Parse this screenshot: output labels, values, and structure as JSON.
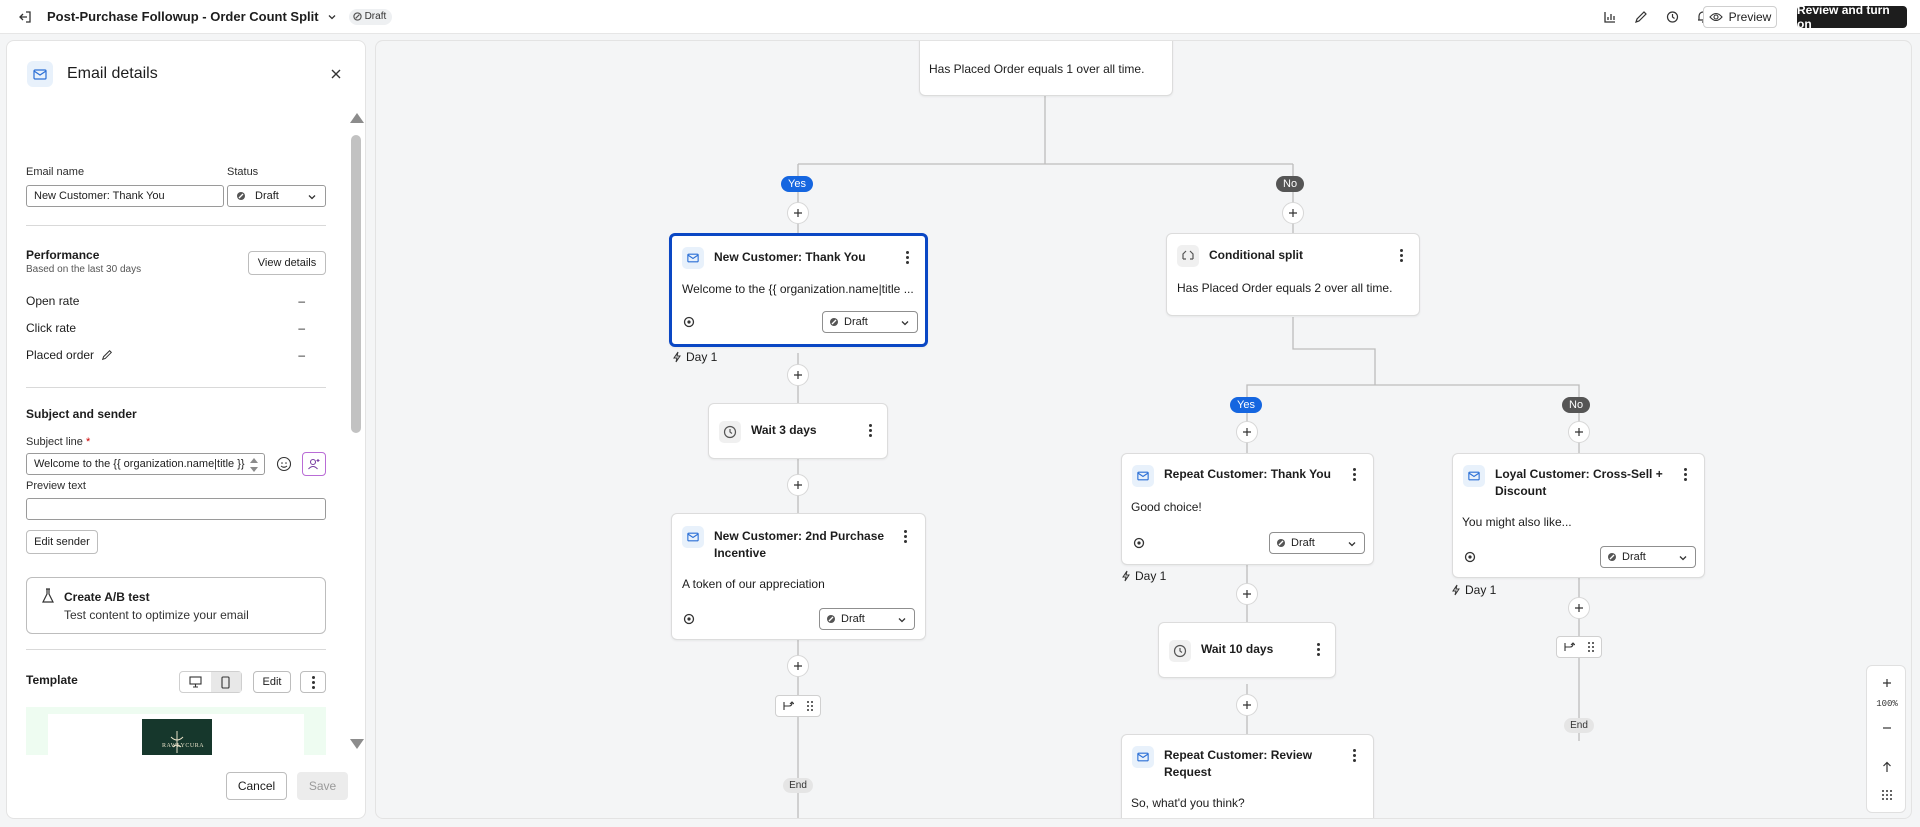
{
  "topbar": {
    "title": "Post-Purchase Followup - Order Count Split",
    "status": "Draft",
    "preview_label": "Preview",
    "review_label": "Review and turn on"
  },
  "panel": {
    "title": "Email details",
    "email_name_label": "Email name",
    "email_name_value": "New Customer: Thank You",
    "status_label": "Status",
    "status_value": "Draft",
    "performance_title": "Performance",
    "performance_sub": "Based on the last 30 days",
    "view_details_label": "View details",
    "metrics": [
      {
        "label": "Open rate",
        "value": "–"
      },
      {
        "label": "Click rate",
        "value": "–"
      },
      {
        "label": "Placed order",
        "value": "–"
      }
    ],
    "subject_sender_title": "Subject and sender",
    "subject_label": "Subject line",
    "required_mark": "*",
    "subject_value": "Welcome to the {{ organization.name|title }}",
    "preview_text_label": "Preview text",
    "preview_text_value": "",
    "edit_sender_label": "Edit sender",
    "ab_title": "Create A/B test",
    "ab_sub": "Test content to optimize your email",
    "template_title": "Template",
    "template_edit_label": "Edit",
    "template_logo_text": "RAWLYCURA",
    "cancel_label": "Cancel",
    "save_label": "Save"
  },
  "canvas": {
    "top_node_body": "Has Placed Order equals 1 over all time.",
    "yes_label": "Yes",
    "no_label": "No",
    "node_new_thank_title": "New Customer: Thank You",
    "node_new_thank_body": "Welcome to the {{ organization.name|title ...",
    "node_new_thank_status": "Draft",
    "day1_label": "Day 1",
    "wait3_label": "Wait 3 days",
    "node_new_2nd_title": "New Customer: 2nd Purchase Incentive",
    "node_new_2nd_body": "A token of our appreciation",
    "node_new_2nd_status": "Draft",
    "end_label": "End",
    "cond_title": "Conditional split",
    "cond_body": "Has Placed Order equals 2 over all time.",
    "yes2_label": "Yes",
    "no2_label": "No",
    "node_repeat_thank_title": "Repeat Customer: Thank You",
    "node_repeat_thank_body": "Good choice!",
    "node_repeat_thank_status": "Draft",
    "day1b_label": "Day 1",
    "wait10_label": "Wait 10 days",
    "node_repeat_review_title": "Repeat Customer: Review Request",
    "node_repeat_review_body": "So, what'd you think?",
    "node_loyal_title": "Loyal Customer: Cross-Sell + Discount",
    "node_loyal_body": "You might also like...",
    "node_loyal_status": "Draft",
    "day1c_label": "Day 1",
    "end2_label": "End",
    "zoom_level": "100%"
  }
}
